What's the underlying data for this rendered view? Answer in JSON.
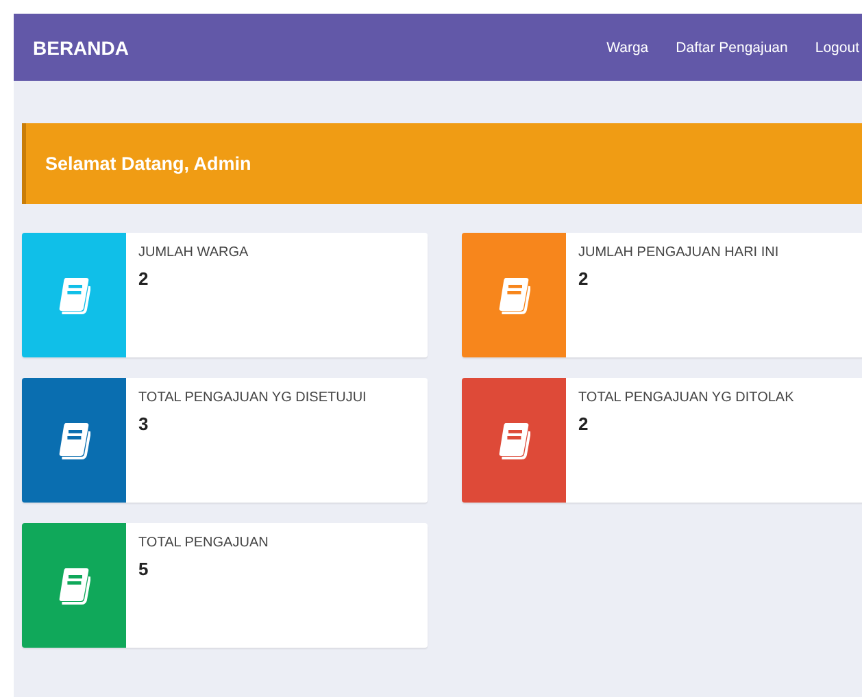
{
  "navbar": {
    "brand": "BERANDA",
    "links": [
      {
        "label": "Warga"
      },
      {
        "label": "Daftar Pengajuan"
      },
      {
        "label": "Logout"
      }
    ]
  },
  "banner": {
    "text": "Selamat Datang, Admin"
  },
  "cards": [
    {
      "label": "JUMLAH WARGA",
      "value": "2",
      "color": "#10bfe8"
    },
    {
      "label": "JUMLAH PENGAJUAN HARI INI",
      "value": "2",
      "color": "#f7861c"
    },
    {
      "label": "TOTAL PENGAJUAN YG DISETUJUI",
      "value": "3",
      "color": "#0a6eb0"
    },
    {
      "label": "TOTAL PENGAJUAN YG DITOLAK",
      "value": "2",
      "color": "#de4a38"
    },
    {
      "label": "TOTAL PENGAJUAN",
      "value": "5",
      "color": "#10a85a"
    }
  ]
}
